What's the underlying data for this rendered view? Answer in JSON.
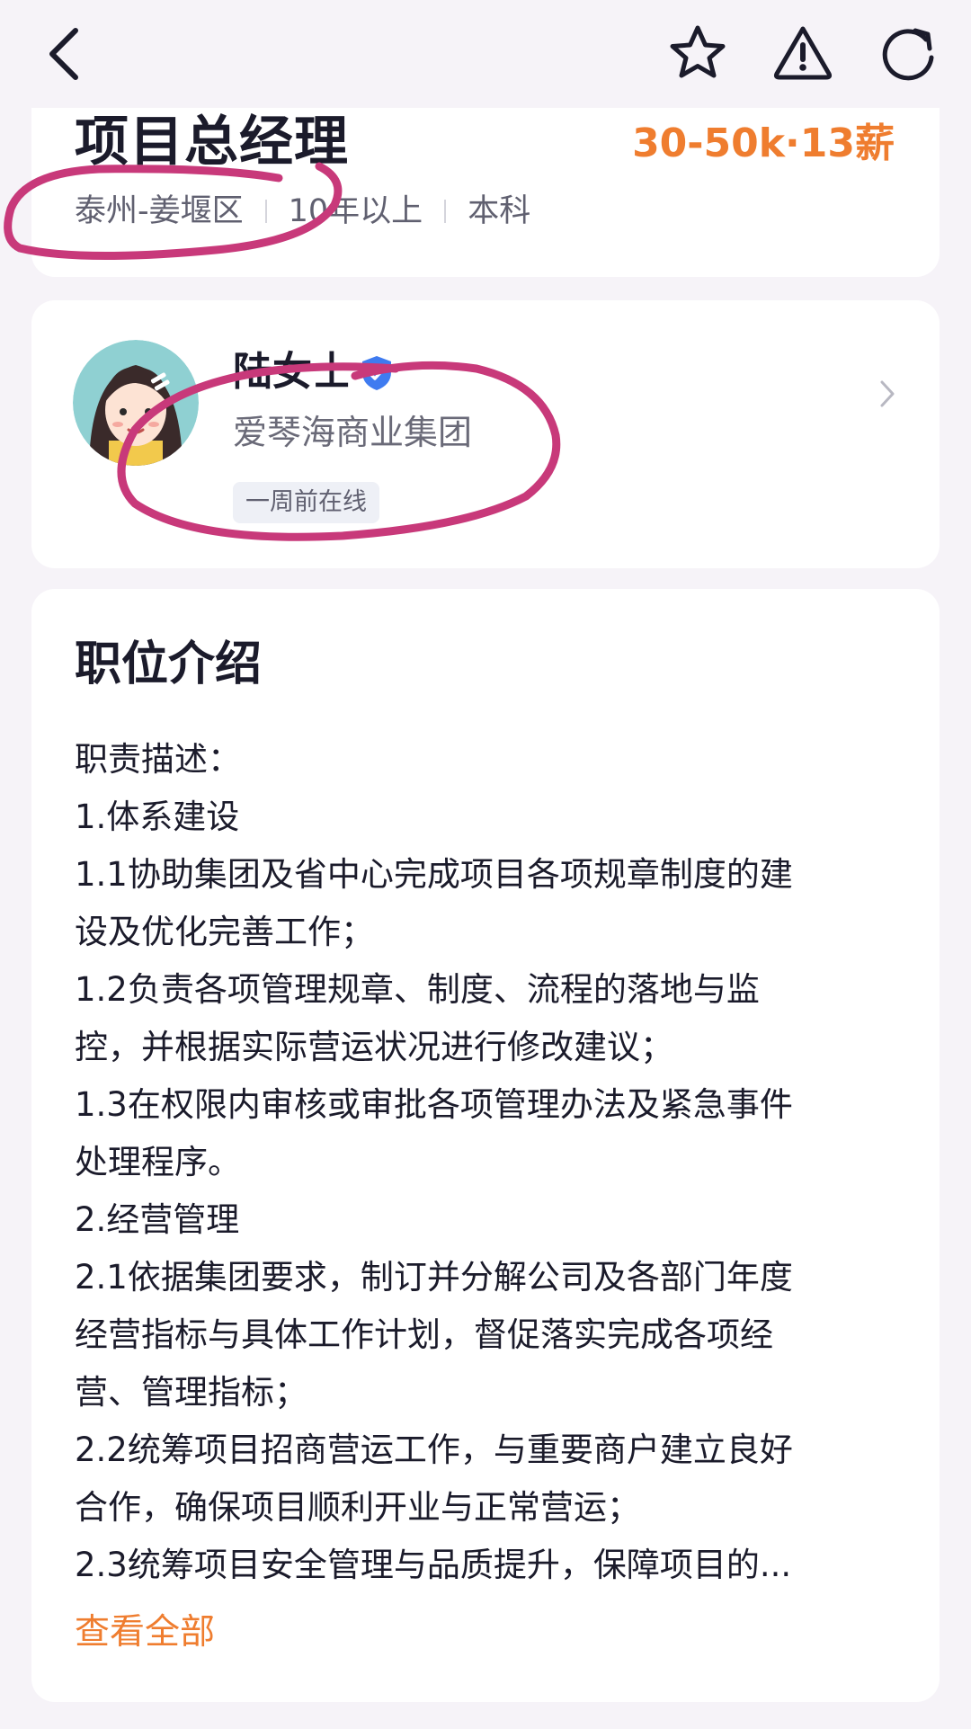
{
  "job": {
    "title": "项目总经理",
    "salary": "30-50k·13薪",
    "location": "泰州-姜堰区",
    "experience": "10年以上",
    "education": "本科"
  },
  "recruiter": {
    "name": "陆女士",
    "company": "爱琴海商业集团",
    "online_status": "一周前在线"
  },
  "description": {
    "title": "职位介绍",
    "lines": [
      "职责描述：",
      "1.体系建设",
      "1.1协助集团及省中心完成项目各项规章制度的建",
      "设及优化完善工作；",
      "1.2负责各项管理规章、制度、流程的落地与监",
      "控，并根据实际营运状况进行修改建议；",
      "1.3在权限内审核或审批各项管理办法及紧急事件",
      "处理程序。",
      "2.经营管理",
      "2.1依据集团要求，制订并分解公司及各部门年度",
      "经营指标与具体工作计划，督促落实完成各项经",
      "营、管理指标；",
      "2.2统筹项目招商营运工作，与重要商户建立良好",
      "合作，确保项目顺利开业与正常营运；",
      "2.3统筹项目安全管理与品质提升，保障项目的..."
    ],
    "view_all": "查看全部"
  },
  "colors": {
    "accent": "#ef7d2f",
    "annotation": "#c8397a",
    "verified": "#3f7bf0"
  }
}
